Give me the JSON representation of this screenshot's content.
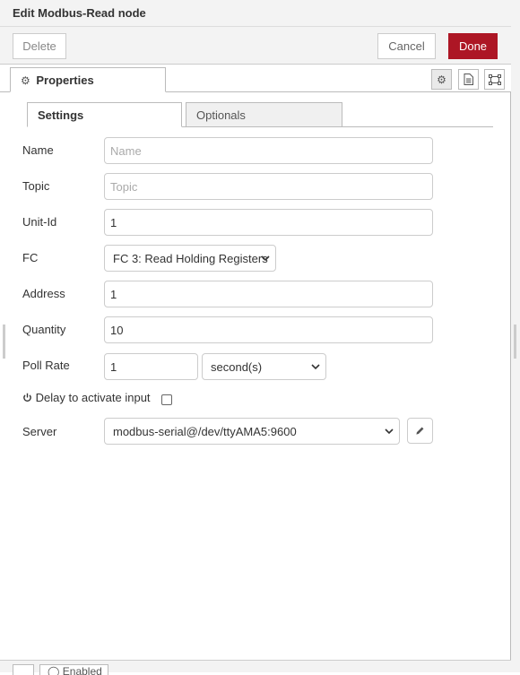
{
  "header": {
    "title": "Edit Modbus-Read node"
  },
  "toolbar": {
    "delete_label": "Delete",
    "cancel_label": "Cancel",
    "done_label": "Done",
    "done_color": "#ad1625"
  },
  "tabs": {
    "properties_label": "Properties"
  },
  "subtabs": {
    "settings_label": "Settings",
    "optionals_label": "Optionals"
  },
  "form": {
    "name": {
      "label": "Name",
      "value": "",
      "placeholder": "Name"
    },
    "topic": {
      "label": "Topic",
      "value": "",
      "placeholder": "Topic"
    },
    "unit_id": {
      "label": "Unit-Id",
      "value": "1"
    },
    "fc": {
      "label": "FC",
      "selected": "FC 3: Read Holding Registers"
    },
    "address": {
      "label": "Address",
      "value": "1"
    },
    "quantity": {
      "label": "Quantity",
      "value": "10"
    },
    "poll_rate": {
      "label": "Poll Rate",
      "value": "1",
      "unit_selected": "second(s)"
    },
    "delay": {
      "label": "Delay to activate input",
      "checked": false
    },
    "server": {
      "label": "Server",
      "selected": "modbus-serial@/dev/ttyAMA5:9600"
    }
  },
  "footer": {
    "enabled_label": "Enabled"
  },
  "icons": {
    "properties_tab": "gear-icon",
    "settings_btn": "gear-icon",
    "description_btn": "document-icon",
    "appearance_btn": "frame-icon",
    "delay": "power-icon",
    "server_edit": "pencil-icon"
  }
}
